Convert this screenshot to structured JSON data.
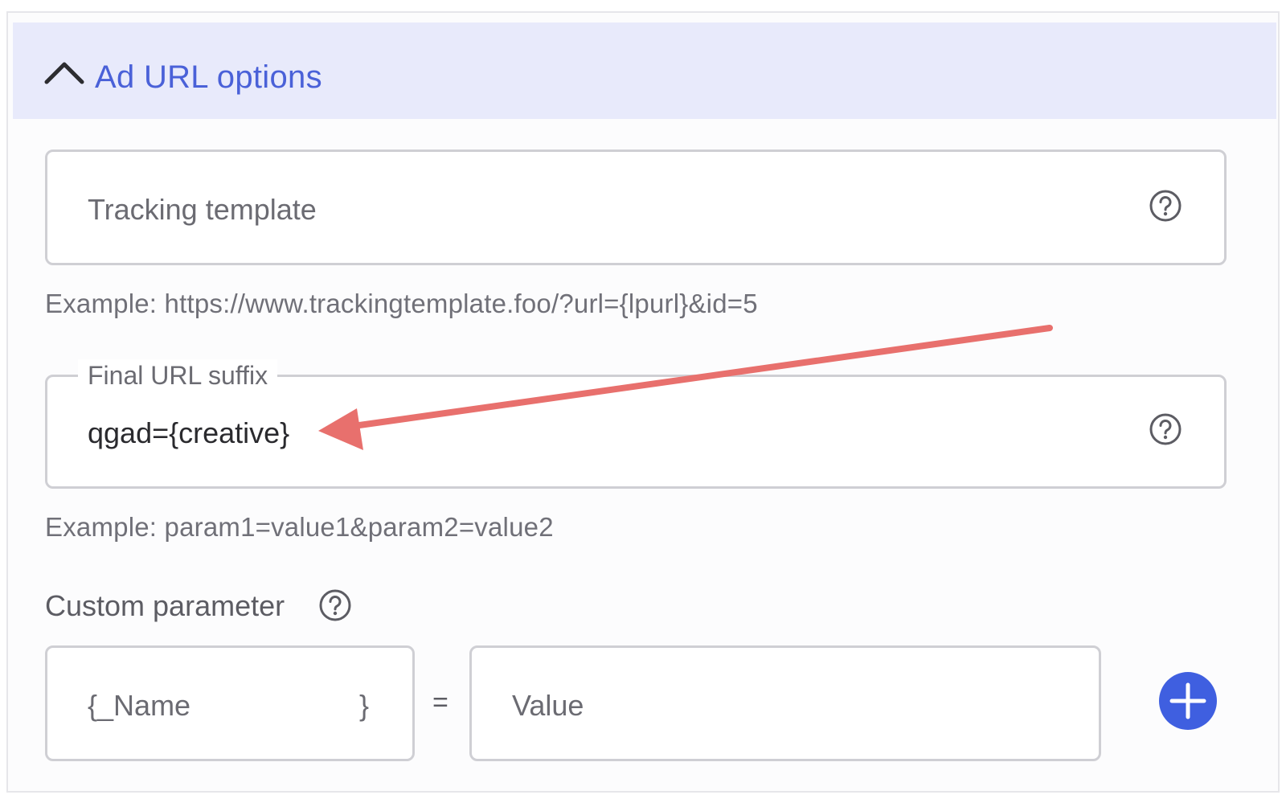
{
  "section": {
    "title": "Ad URL options",
    "expanded": true
  },
  "tracking_template": {
    "placeholder": "Tracking template",
    "value": "",
    "example": "Example: https://www.trackingtemplate.foo/?url={lpurl}&id=5"
  },
  "final_url_suffix": {
    "label": "Final URL suffix",
    "value": "qgad={creative}",
    "example": "Example: param1=value1&param2=value2"
  },
  "custom_parameter": {
    "label": "Custom parameter",
    "name_prefix": "{_",
    "name_placeholder": "Name",
    "name_suffix": "}",
    "equals": "=",
    "value_placeholder": "Value"
  },
  "colors": {
    "accent": "#4a61d8",
    "header_bg": "#e8eafb",
    "add_button": "#3f5fe0",
    "annotation_arrow": "#e8706d"
  },
  "icons": {
    "collapse": "chevron-up-icon",
    "help": "help-circle-icon",
    "add": "plus-icon"
  }
}
